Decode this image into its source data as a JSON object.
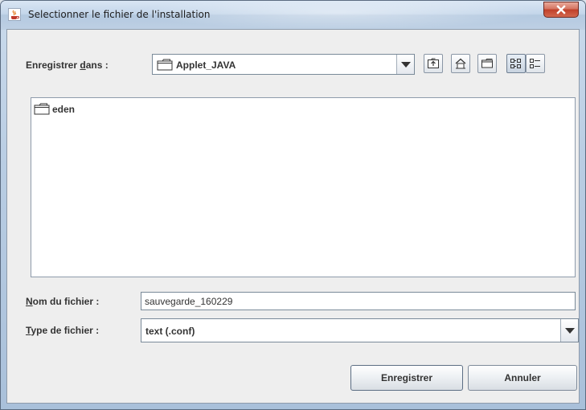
{
  "window": {
    "title": "Selectionner le fichier de l'installation"
  },
  "toolbar": {
    "save_in_label_before": "Enregistrer ",
    "save_in_label_mnemonic": "d",
    "save_in_label_after": "ans :",
    "current_folder": "Applet_JAVA"
  },
  "file_list": {
    "items": [
      {
        "name": "eden",
        "icon": "folder-icon"
      }
    ]
  },
  "filename": {
    "label_mnemonic": "N",
    "label_rest": "om du fichier :",
    "value": "sauvegarde_160229"
  },
  "filetype": {
    "label_mnemonic": "T",
    "label_rest": "ype de fichier :",
    "selected": "text (.conf)"
  },
  "buttons": {
    "save": "Enregistrer",
    "cancel": "Annuler"
  },
  "icons": {
    "app": "java-cup-icon",
    "close": "close-icon",
    "up_folder": "up-folder-icon",
    "home": "home-icon",
    "new_folder": "new-folder-icon",
    "list_view": "list-view-icon",
    "details_view": "details-view-icon"
  },
  "colors": {
    "close_button": "#c0402a",
    "dialog_background": "#eeeeee",
    "label_text": "#333333"
  }
}
